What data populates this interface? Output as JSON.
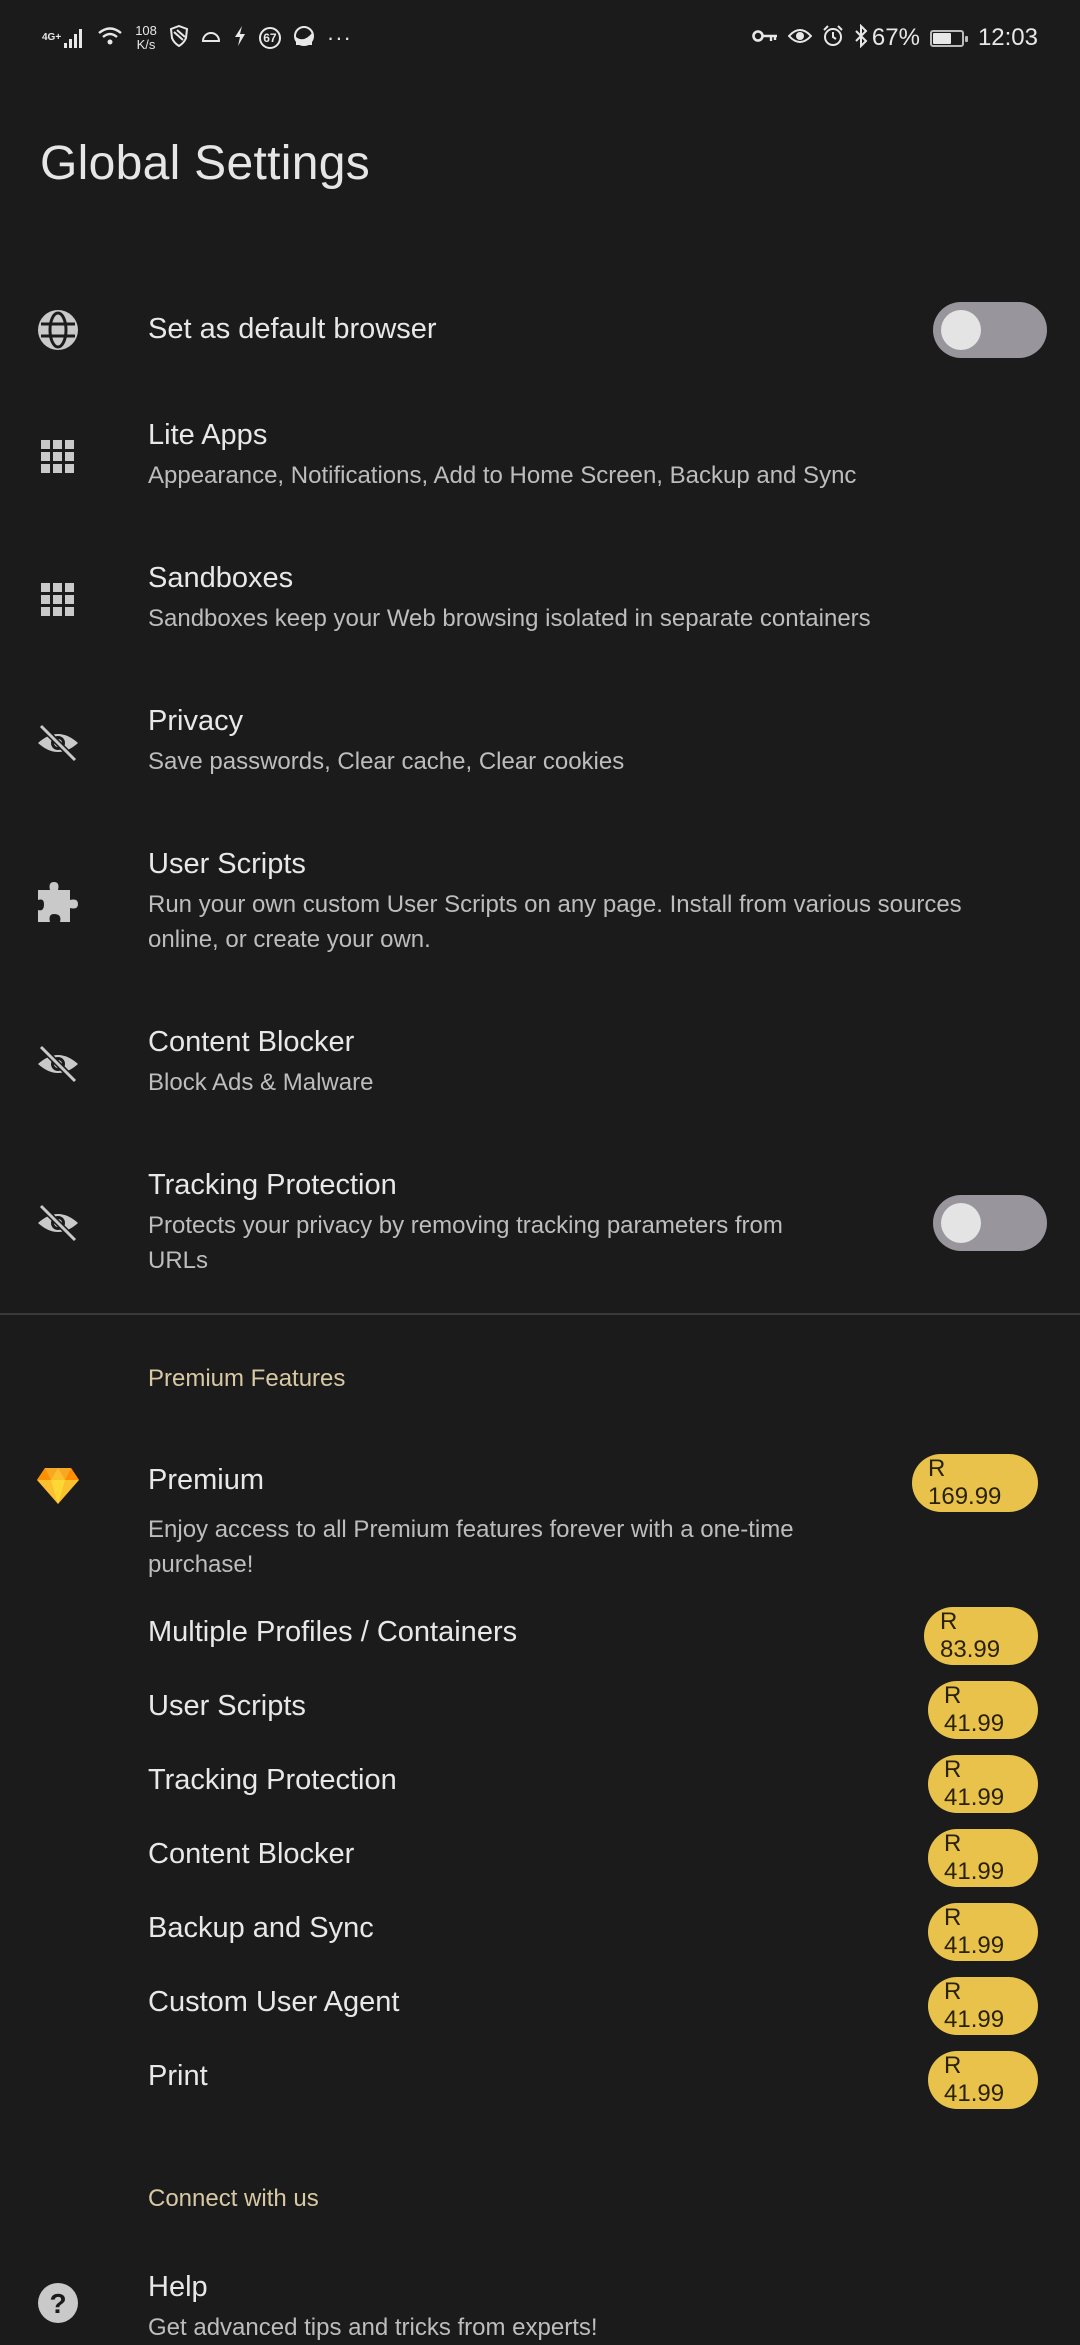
{
  "status_bar": {
    "network_type": "4G+",
    "speed_value": "108",
    "speed_unit": "K/s",
    "notification_badge": "67",
    "overflow": "···",
    "battery_percent": "67%",
    "battery_level": 0.67,
    "time": "12:03",
    "left_icons": [
      "signal-icon",
      "wifi-icon",
      "shield-icon",
      "half-circle-icon",
      "flash-icon",
      "badge-67-icon",
      "app-icon",
      "more-icon"
    ],
    "right_icons": [
      "vpn-key-icon",
      "eye-icon",
      "alarm-icon",
      "bluetooth-icon",
      "battery-icon"
    ]
  },
  "page": {
    "title": "Global Settings"
  },
  "settings": [
    {
      "icon": "globe-icon",
      "title": "Set as default browser",
      "subtitle": "",
      "toggle": false
    },
    {
      "icon": "grid-icon",
      "title": "Lite Apps",
      "subtitle": "Appearance, Notifications, Add to Home Screen, Backup and Sync"
    },
    {
      "icon": "grid-icon",
      "title": "Sandboxes",
      "subtitle": "Sandboxes keep your Web browsing isolated in separate containers"
    },
    {
      "icon": "eye-off-icon",
      "title": "Privacy",
      "subtitle": "Save passwords, Clear cache, Clear cookies"
    },
    {
      "icon": "puzzle-icon",
      "title": "User Scripts",
      "subtitle_line1": "Run your own custom User Scripts on any page. Install from various sources",
      "subtitle_line2": "online, or create your own."
    },
    {
      "icon": "eye-off-icon",
      "title": "Content Blocker",
      "subtitle": "Block Ads & Malware"
    },
    {
      "icon": "eye-off-icon",
      "title": "Tracking Protection",
      "subtitle_line1": "Protects your privacy by removing tracking parameters from",
      "subtitle_line2": "URLs",
      "toggle": false
    }
  ],
  "premium_section": {
    "header": "Premium Features",
    "premium": {
      "icon": "diamond-icon",
      "title": "Premium",
      "price": "R 169.99",
      "desc_line1": "Enjoy access to all Premium features forever with a one-time",
      "desc_line2": "purchase!"
    },
    "features": [
      {
        "title": "Multiple Profiles / Containers",
        "price": "R 83.99"
      },
      {
        "title": "User Scripts",
        "price": "R 41.99"
      },
      {
        "title": "Tracking Protection",
        "price": "R 41.99"
      },
      {
        "title": "Content Blocker",
        "price": "R 41.99"
      },
      {
        "title": "Backup and Sync",
        "price": "R 41.99"
      },
      {
        "title": "Custom User Agent",
        "price": "R 41.99"
      },
      {
        "title": "Print",
        "price": "R 41.99"
      }
    ]
  },
  "connect_section": {
    "header": "Connect with us",
    "help": {
      "icon": "help-icon",
      "title": "Help",
      "subtitle": "Get advanced tips and tricks from experts!"
    }
  },
  "colors": {
    "background": "#1b1b1c",
    "accent_header": "#d8c9a3",
    "price_pill": "#e8c24a",
    "toggle_track": "#98969c"
  }
}
